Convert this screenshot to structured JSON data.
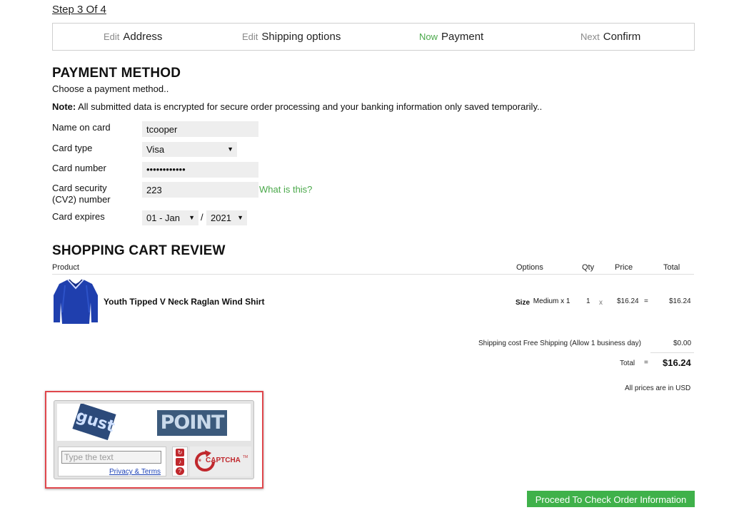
{
  "step_indicator": "Step 3 Of 4",
  "steps": [
    {
      "prefix": "Edit",
      "label": "Address"
    },
    {
      "prefix": "Edit",
      "label": "Shipping options"
    },
    {
      "prefix": "Now",
      "label": "Payment"
    },
    {
      "prefix": "Next",
      "label": "Confirm"
    }
  ],
  "payment": {
    "title": "PAYMENT METHOD",
    "subtitle": "Choose a payment method..",
    "note_label": "Note:",
    "note_text": " All submitted data is encrypted for secure order processing and your banking information only saved temporarily..",
    "name_label": "Name on card",
    "name_value": "tcooper",
    "card_type_label": "Card type",
    "card_type_value": "Visa",
    "card_number_label": "Card number",
    "card_number_value": "••••••••••••",
    "security_label_1": "Card security",
    "security_label_2": "(CV2) number",
    "security_value": "223",
    "what_is_this": "What is this?",
    "expires_label": "Card expires",
    "expires_month": "01 - Jan",
    "expires_sep": "/",
    "expires_year": "2021"
  },
  "cart": {
    "title": "SHOPPING CART REVIEW",
    "columns": {
      "product": "Product",
      "options": "Options",
      "qty": "Qty",
      "price": "Price",
      "total": "Total"
    },
    "items": [
      {
        "name": "Youth Tipped V Neck Raglan Wind Shirt",
        "option_label": "Size",
        "option_value": "Medium x 1",
        "qty": "1",
        "times": "x",
        "price": "$16.24",
        "equals": "=",
        "total": "$16.24"
      }
    ],
    "shipping_label": "Shipping cost Free Shipping (Allow 1 business day)",
    "shipping_value": "$0.00",
    "total_label": "Total",
    "total_equals": "=",
    "total_value": "$16.24",
    "currency_note": "All prices are in USD"
  },
  "captcha": {
    "word1": "gust",
    "word2": "POINT",
    "placeholder": "Type the text",
    "privacy_link": "Privacy & Terms",
    "logo_text": "CAPTCHA",
    "logo_prefix": "re",
    "logo_tm": "TM"
  },
  "proceed_button": "Proceed To Check Order Information",
  "colors": {
    "accent_green": "#3fb14a",
    "captcha_red": "#c0282d",
    "highlight_border": "#e0474c"
  }
}
